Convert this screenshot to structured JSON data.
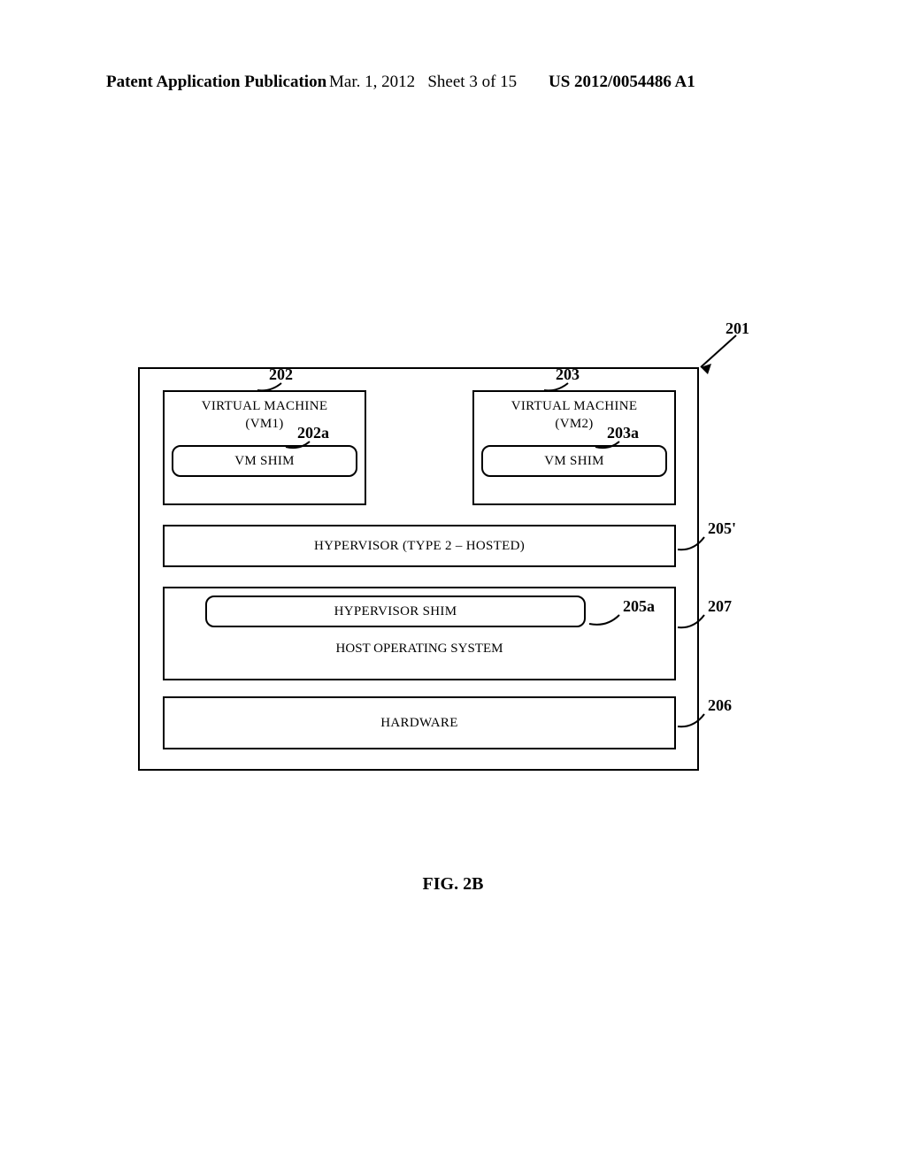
{
  "header": {
    "left": "Patent Application Publication",
    "mid_date": "Mar. 1, 2012",
    "mid_sheet": "Sheet 3 of 15",
    "right": "US 2012/0054486 A1"
  },
  "figure": {
    "caption": "FIG. 2B",
    "refs": {
      "r201": "201",
      "r202": "202",
      "r203": "203",
      "r202a": "202a",
      "r203a": "203a",
      "r205p": "205'",
      "r205a": "205a",
      "r207": "207",
      "r206": "206"
    },
    "blocks": {
      "vm1_line1": "VIRTUAL MACHINE",
      "vm1_line2": "(VM1)",
      "vm2_line1": "VIRTUAL MACHINE",
      "vm2_line2": "(VM2)",
      "vm_shim": "VM SHIM",
      "hypervisor": "HYPERVISOR (TYPE 2 – HOSTED)",
      "hypervisor_shim": "HYPERVISOR SHIM",
      "host_os": "HOST OPERATING SYSTEM",
      "hardware": "HARDWARE"
    }
  }
}
